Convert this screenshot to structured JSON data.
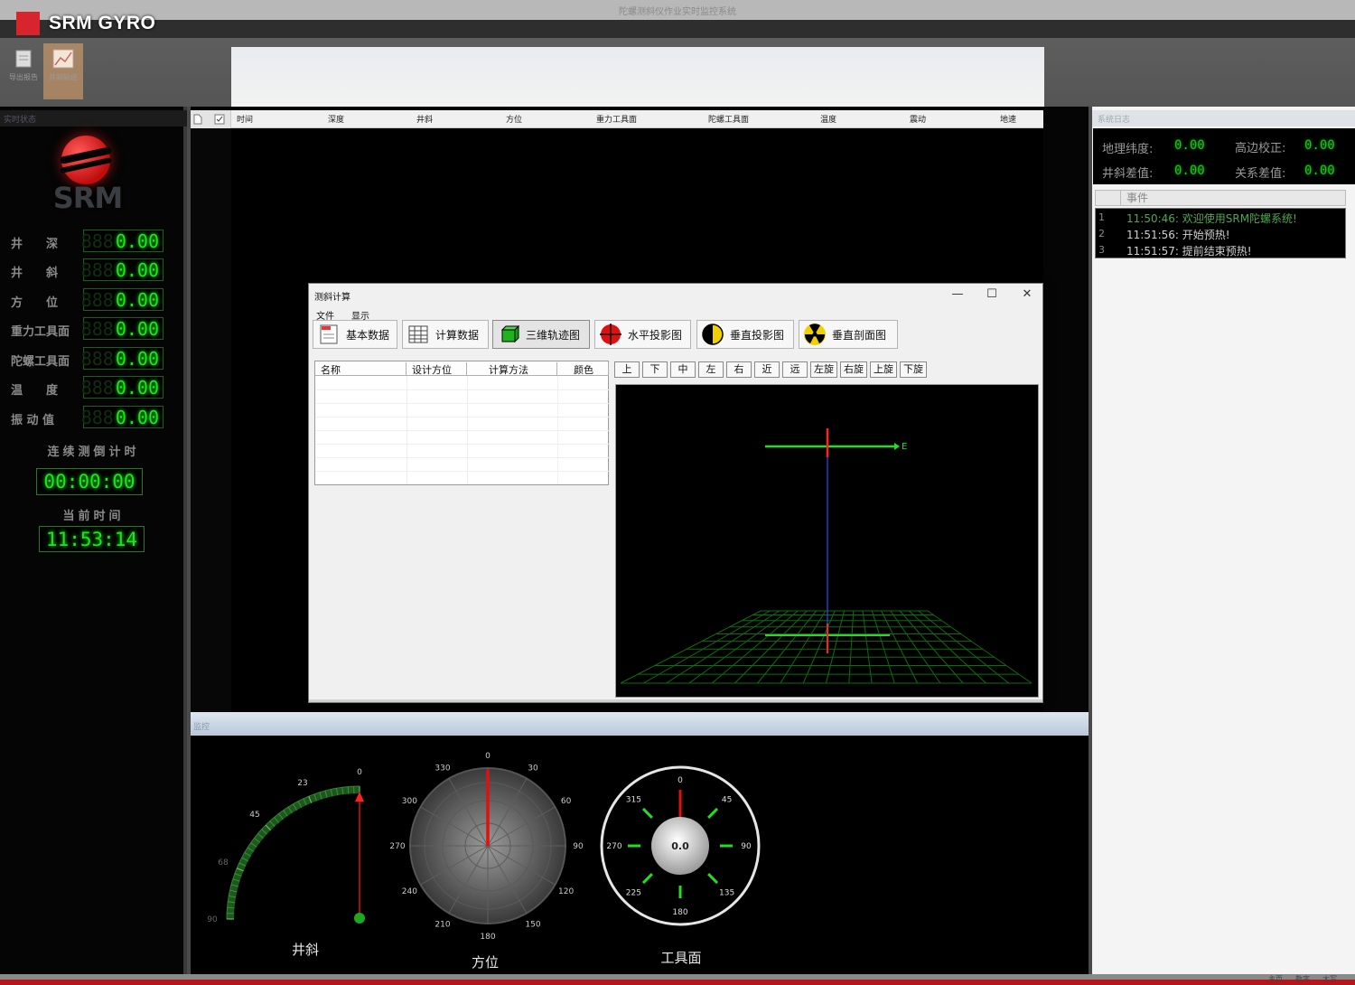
{
  "brand": {
    "name": "SRM GYRO",
    "color": "#d8242c"
  },
  "window": {
    "title": "陀螺测斜仪作业实时监控系统"
  },
  "ribbon": {
    "buttons": [
      {
        "label": "导出报告",
        "icon": "report-icon"
      },
      {
        "label": "井斜轨迹",
        "icon": "trajectory-icon"
      }
    ]
  },
  "left_panel": {
    "header": "实时状态",
    "logo_text": "SRM",
    "params": [
      {
        "label": "井　　深",
        "value": "0.00",
        "ghost": "888"
      },
      {
        "label": "井　　斜",
        "value": "0.00",
        "ghost": "888"
      },
      {
        "label": "方　　位",
        "value": "0.00",
        "ghost": "888"
      },
      {
        "label": "重力工具面",
        "value": "0.00",
        "ghost": "888"
      },
      {
        "label": "陀螺工具面",
        "value": "0.00",
        "ghost": "888"
      },
      {
        "label": "温　　度",
        "value": "0.00",
        "ghost": "888"
      },
      {
        "label": "振 动 值",
        "value": "0.00",
        "ghost": "888"
      }
    ],
    "countdown_label": "连续测倒计时",
    "countdown_value": "00:00:00",
    "current_time_label": "当前时间",
    "current_time_value": "11:53:14"
  },
  "data_grid": {
    "columns": [
      "时间",
      "深度",
      "井斜",
      "方位",
      "重力工具面",
      "陀螺工具面",
      "温度",
      "震动",
      "地速"
    ]
  },
  "dialog": {
    "title": "测斜计算",
    "menu": [
      "文件",
      "显示"
    ],
    "tools": [
      {
        "label": "基本数据",
        "icon": "document-icon"
      },
      {
        "label": "计算数据",
        "icon": "table-icon"
      },
      {
        "label": "三维轨迹图",
        "icon": "cube-icon"
      },
      {
        "label": "水平投影图",
        "icon": "crosshair-icon"
      },
      {
        "label": "垂直投影图",
        "icon": "half-moon-icon"
      },
      {
        "label": "垂直剖面图",
        "icon": "radiation-icon"
      }
    ],
    "table_columns": [
      "名称",
      "设计方位",
      "计算方法",
      "颜色"
    ],
    "view_buttons": [
      "上",
      "下",
      "中",
      "左",
      "右",
      "近",
      "远",
      "左旋",
      "右旋",
      "上旋",
      "下旋"
    ],
    "axis_label": "E"
  },
  "bottom": {
    "splitter_label": "监控",
    "inclination": {
      "label": "井斜",
      "ticks": [
        "0",
        "23",
        "45",
        "68",
        "90"
      ]
    },
    "azimuth": {
      "label": "方位",
      "ticks": [
        "0",
        "30",
        "60",
        "90",
        "120",
        "150",
        "180",
        "210",
        "240",
        "270",
        "300",
        "330"
      ]
    },
    "toolface": {
      "label": "工具面",
      "value": "0.0",
      "ticks": [
        "0",
        "45",
        "90",
        "135",
        "180",
        "225",
        "270",
        "315"
      ]
    }
  },
  "right_panel": {
    "header": "系统日志",
    "info": [
      {
        "label": "地理纬度:",
        "value": "0.00"
      },
      {
        "label": "高边校正:",
        "value": "0.00"
      },
      {
        "label": "井斜差值:",
        "value": "0.00"
      },
      {
        "label": "关系差值:",
        "value": "0.00"
      }
    ],
    "log_header": "事件",
    "logs": [
      {
        "num": "1",
        "text": "11:50:46: 欢迎使用SRM陀螺系统!",
        "color": "#4fa84f"
      },
      {
        "num": "2",
        "text": "11:51:56: 开始预热!",
        "color": "#cfcfcf"
      },
      {
        "num": "3",
        "text": "11:51:57: 提前结束预热!",
        "color": "#cfcfcf"
      }
    ]
  },
  "status_bar": {
    "items": [
      "主页",
      "数字",
      "大写"
    ]
  }
}
